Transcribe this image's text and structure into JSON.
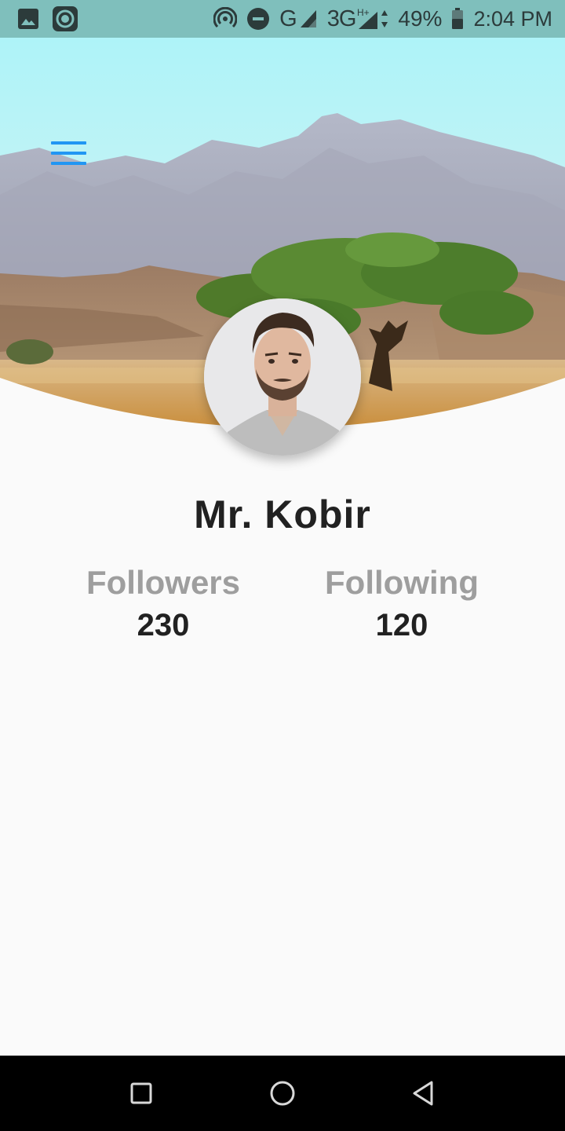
{
  "status_bar": {
    "network_type": "G",
    "network_type_2": "3G",
    "battery_percent": "49%",
    "time": "2:04 PM",
    "icons": [
      "image-icon",
      "record-icon",
      "hotspot-icon",
      "do-not-disturb-icon",
      "signal-icon",
      "data-arrows-icon",
      "battery-icon"
    ]
  },
  "header": {
    "menu_icon": "hamburger-menu-icon",
    "cover_image": "mountain-desert-tree-landscape"
  },
  "profile": {
    "name": "Mr. Kobir",
    "avatar": "man-portrait-photo",
    "stats": [
      {
        "label": "Followers",
        "value": "230"
      },
      {
        "label": "Following",
        "value": "120"
      }
    ]
  },
  "nav_bar": {
    "icons": [
      "recents-square-icon",
      "home-circle-icon",
      "back-triangle-icon"
    ]
  },
  "colors": {
    "status_bar": "#7fbfbc",
    "accent": "#2196f3",
    "background": "#fafafa",
    "stat_label": "#9e9e9e",
    "text_dark": "#212121"
  }
}
